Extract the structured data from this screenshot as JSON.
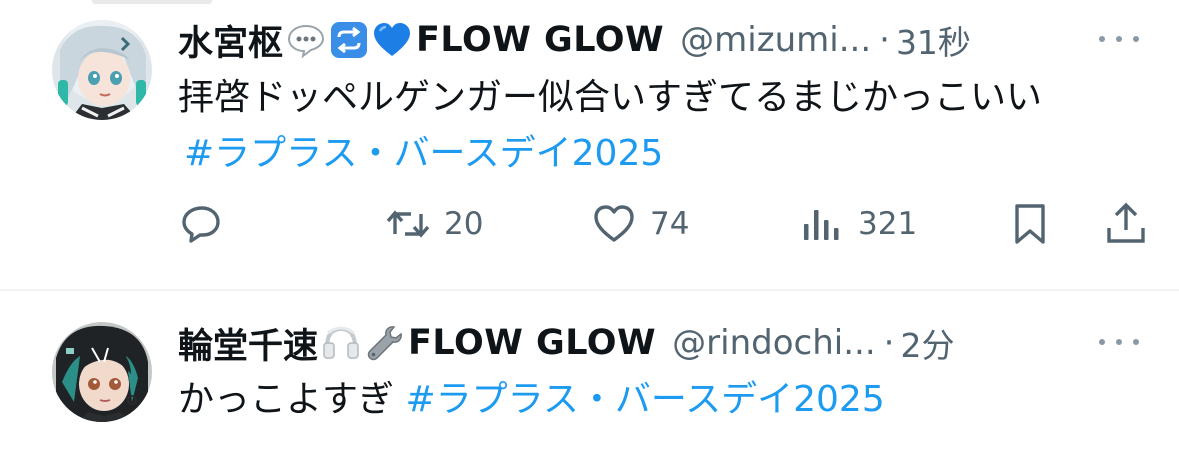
{
  "tweets": [
    {
      "display_name": "水宮枢",
      "name_emojis": [
        "speech-bubble",
        "repeat-button",
        "blue-heart"
      ],
      "name_suffix": "FLOW GLOW",
      "handle": "@mizumi...",
      "separator": "·",
      "time": "31秒",
      "text_line1": "拝啓ドッペルゲンガー似合いすぎてるまじかっこいい",
      "text_plain": "",
      "hashtag": "#ラプラス・バースデイ2025",
      "actions": {
        "reply_count": "",
        "retweet_count": "20",
        "like_count": "74",
        "view_count": "321"
      }
    },
    {
      "display_name": "輪堂千速",
      "name_emojis": [
        "headphones",
        "wrench"
      ],
      "name_suffix": "FLOW GLOW",
      "handle": "@rindochi...",
      "separator": "·",
      "time": "2分",
      "text_plain": "かっこよすぎ",
      "hashtag": "#ラプラス・バースデイ2025"
    }
  ],
  "colors": {
    "accent": "#1d9bf0",
    "text": "#0f1419",
    "secondary": "#536471",
    "divider": "#eff3f4"
  },
  "icons": {
    "reply": "reply-icon",
    "retweet": "retweet-icon",
    "like": "like-icon",
    "views": "views-icon",
    "bookmark": "bookmark-icon",
    "share": "share-icon",
    "more": "more-icon"
  }
}
